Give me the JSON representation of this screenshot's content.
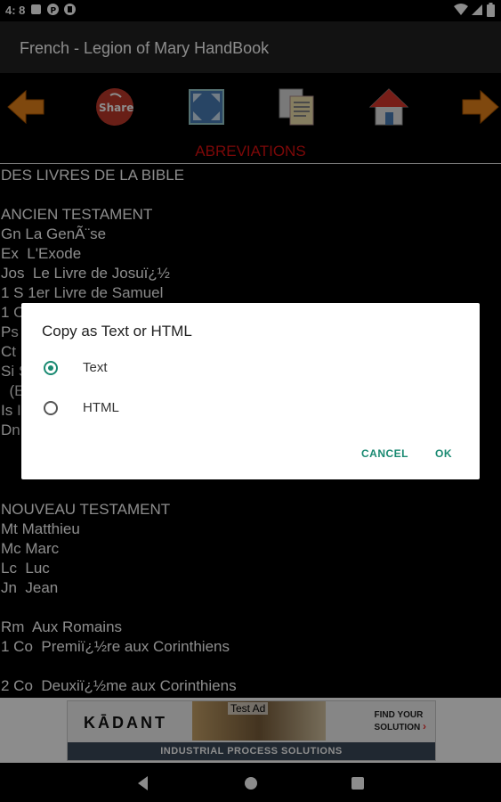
{
  "status_bar": {
    "time": "4: 8"
  },
  "app_bar": {
    "title": "French - Legion of Mary HandBook"
  },
  "toolbar": {
    "items": [
      {
        "icon": "arrow-left-icon"
      },
      {
        "icon": "share-icon",
        "label": "Share"
      },
      {
        "icon": "fullscreen-icon"
      },
      {
        "icon": "copy-icon"
      },
      {
        "icon": "home-icon"
      },
      {
        "icon": "arrow-right-icon"
      }
    ]
  },
  "section": {
    "heading": "ABREVIATIONS"
  },
  "content": {
    "lines": [
      "DES LIVRES DE LA BIBLE",
      "",
      "ANCIEN TESTAMENT",
      "Gn La GenÃ¨se",
      "Ex  L'Exode",
      "Jos  Le Livre de Josuï¿½",
      "1 S 1er Livre de Samuel",
      "1 C",
      "Ps",
      "Ct",
      "Si S",
      "  (E",
      "Is I",
      "Dn",
      "",
      "",
      "",
      "NOUVEAU TESTAMENT",
      "Mt Matthieu",
      "Mc Marc",
      "Lc  Luc",
      "Jn  Jean",
      "",
      "Rm  Aux Romains",
      "1 Co  Premiï¿½re aux Corinthiens",
      "",
      "2 Co  Deuxiï¿½me aux Corinthiens"
    ]
  },
  "ad": {
    "logo": "KĀDANT",
    "label": "Test Ad",
    "cta_line1": "FIND YOUR",
    "cta_line2": "SOLUTION",
    "strip": "INDUSTRIAL PROCESS SOLUTIONS"
  },
  "dialog": {
    "title": "Copy as Text or HTML",
    "options": [
      {
        "label": "Text",
        "selected": true
      },
      {
        "label": "HTML",
        "selected": false
      }
    ],
    "cancel": "CANCEL",
    "ok": "OK"
  },
  "colors": {
    "accent": "#1a8a72",
    "heading": "#e01010",
    "app_bar": "#212121"
  }
}
